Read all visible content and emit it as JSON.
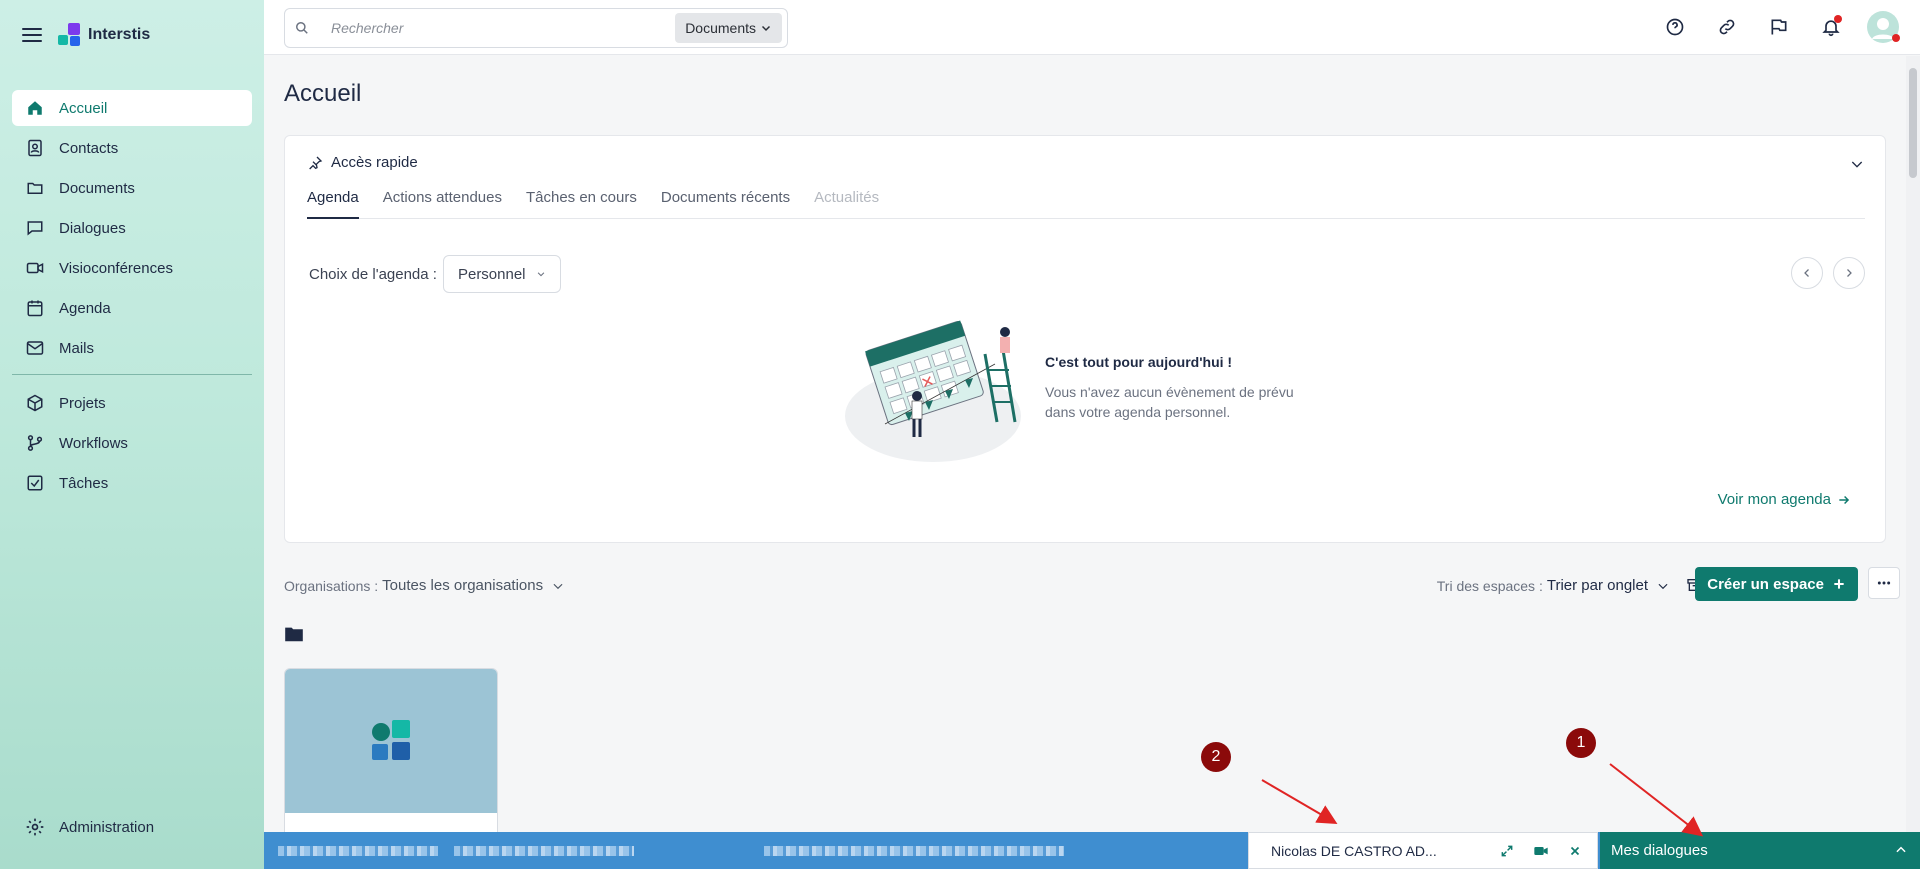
{
  "app": {
    "name": "Interstis"
  },
  "sidebar": {
    "items": [
      {
        "label": "Accueil",
        "icon": "home-icon"
      },
      {
        "label": "Contacts",
        "icon": "contacts-icon"
      },
      {
        "label": "Documents",
        "icon": "folder-icon"
      },
      {
        "label": "Dialogues",
        "icon": "chat-icon"
      },
      {
        "label": "Visioconférences",
        "icon": "video-icon"
      },
      {
        "label": "Agenda",
        "icon": "calendar-icon"
      },
      {
        "label": "Mails",
        "icon": "mail-icon"
      }
    ],
    "secondary": [
      {
        "label": "Projets",
        "icon": "cube-icon"
      },
      {
        "label": "Workflows",
        "icon": "workflow-icon"
      },
      {
        "label": "Tâches",
        "icon": "task-icon"
      }
    ],
    "admin": "Administration"
  },
  "search": {
    "placeholder": "Rechercher",
    "scope": "Documents"
  },
  "page": {
    "title": "Accueil"
  },
  "quick_access": {
    "title": "Accès rapide",
    "tabs": [
      "Agenda",
      "Actions attendues",
      "Tâches en cours",
      "Documents récents",
      "Actualités"
    ],
    "agenda_label": "Choix de l'agenda :",
    "agenda_value": "Personnel",
    "empty_title": "C'est tout pour aujourd'hui !",
    "empty_sub": "Vous n'avez aucun évènement de prévu dans votre agenda personnel.",
    "link": "Voir mon agenda"
  },
  "filters": {
    "org_label": "Organisations :",
    "org_value": "Toutes les organisations",
    "sort_label": "Tri des espaces :",
    "sort_value": "Trier par onglet",
    "create_label": "Créer un espace"
  },
  "chat": {
    "name": "Nicolas DE CASTRO AD...",
    "dialogs_label": "Mes dialogues"
  },
  "annotations": [
    "1",
    "2"
  ],
  "colors": {
    "accent": "#0f7a6e",
    "marker": "#8b0a0a",
    "bar": "#3f8ed0"
  }
}
